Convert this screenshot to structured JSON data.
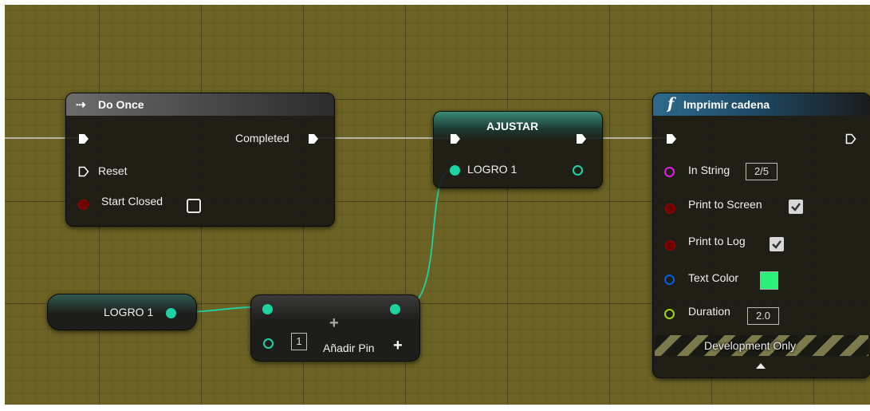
{
  "nodes": {
    "do_once": {
      "title": "Do Once",
      "completed_label": "Completed",
      "reset_label": "Reset",
      "start_closed_label": "Start Closed"
    },
    "ajustar": {
      "title": "AJUSTAR",
      "var_label": "LOGRO 1"
    },
    "imprimir": {
      "title": "Imprimir cadena",
      "title_icon": "f",
      "in_string_label": "In String",
      "in_string_value": "2/5",
      "print_screen_label": "Print to Screen",
      "print_log_label": "Print to Log",
      "text_color_label": "Text Color",
      "duration_label": "Duration",
      "duration_value": "2.0",
      "dev_only_label": "Development Only"
    },
    "logro_get": {
      "label": "LOGRO 1"
    },
    "make_array": {
      "index_value": "1",
      "add_pin_label": "Añadir Pin"
    }
  },
  "colors": {
    "graph_bg": "#6b6224",
    "exec_wire": "#d0d0d0",
    "int_pin": "#1ed3a3",
    "string_pin": "#e020e0",
    "bool_pin": "#8f0000",
    "struct_pin": "#0060e0",
    "float_pin": "#9dd41c",
    "text_color_swatch": "#2af07a"
  },
  "icons": [
    "do-once-icon",
    "function-icon",
    "exec-pin-icon",
    "add-pin-icon",
    "expand-arrow-icon",
    "checkbox-checked-icon"
  ]
}
